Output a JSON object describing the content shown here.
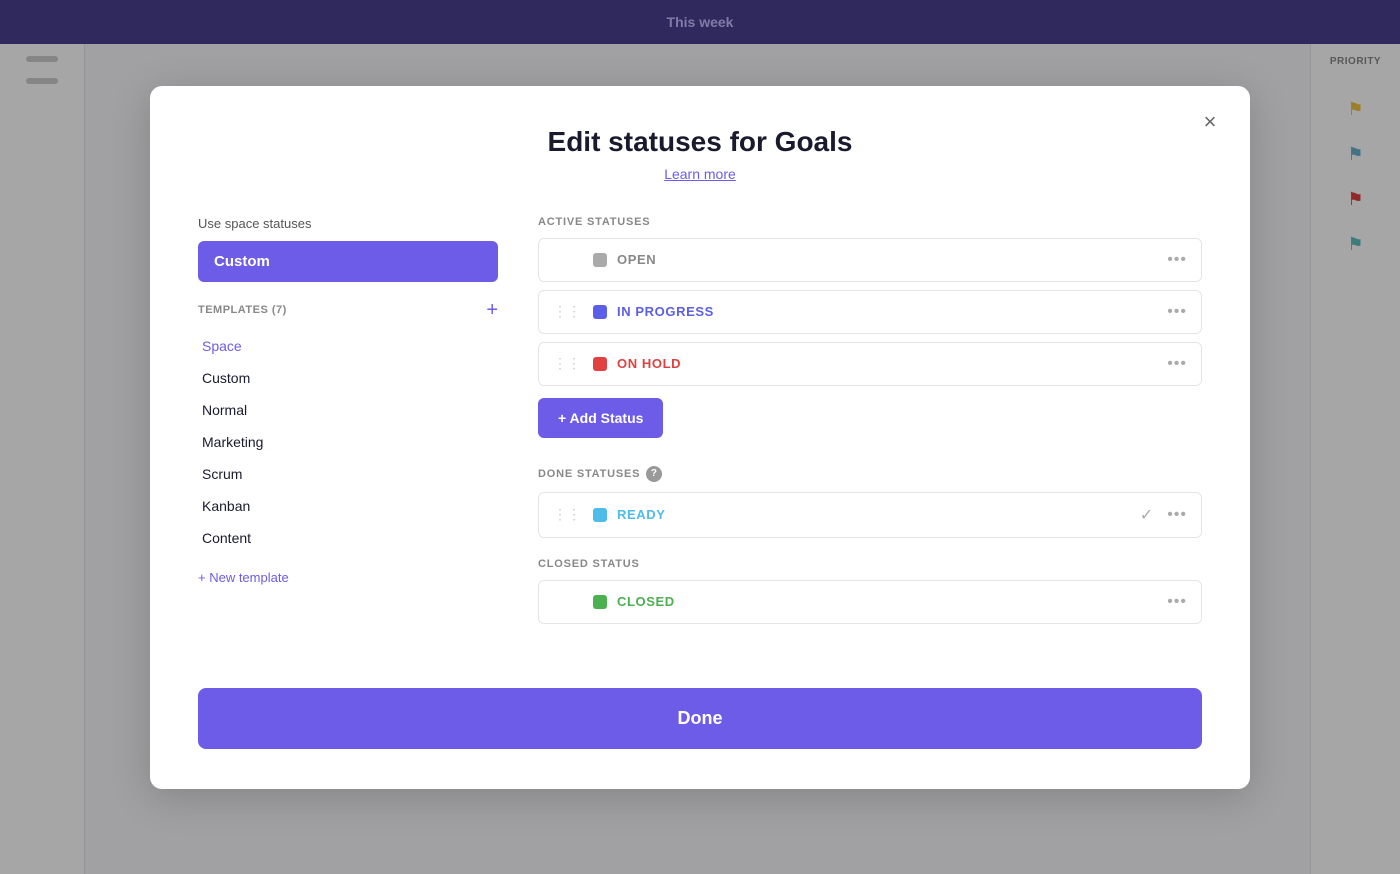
{
  "app": {
    "topbar_title": "This week",
    "priority_label": "PRIORITY"
  },
  "dialog": {
    "title": "Edit statuses for Goals",
    "learn_more": "Learn more",
    "close_label": "×",
    "left": {
      "use_space_label": "Use space statuses",
      "custom_btn_label": "Custom",
      "templates_label": "TEMPLATES (7)",
      "templates_add_icon": "+",
      "templates": [
        {
          "label": "Space",
          "style": "active"
        },
        {
          "label": "Custom",
          "style": "plain"
        },
        {
          "label": "Normal",
          "style": "plain"
        },
        {
          "label": "Marketing",
          "style": "plain"
        },
        {
          "label": "Scrum",
          "style": "plain"
        },
        {
          "label": "Kanban",
          "style": "plain"
        },
        {
          "label": "Content",
          "style": "plain"
        }
      ],
      "new_template_label": "+ New template"
    },
    "right": {
      "active_section_label": "ACTIVE STATUSES",
      "active_statuses": [
        {
          "name": "OPEN",
          "color": "gray",
          "dot_class": "dot-gray",
          "name_class": "name-gray",
          "has_drag": false
        },
        {
          "name": "IN PROGRESS",
          "color": "blue",
          "dot_class": "dot-blue",
          "name_class": "name-blue",
          "has_drag": true
        },
        {
          "name": "ON HOLD",
          "color": "red",
          "dot_class": "dot-red",
          "name_class": "name-red",
          "has_drag": true
        }
      ],
      "add_status_label": "+ Add Status",
      "done_section_label": "DONE STATUSES",
      "done_statuses": [
        {
          "name": "READY",
          "color": "blue2",
          "dot_class": "dot-blue2",
          "name_class": "name-blue2",
          "has_drag": true,
          "has_check": true
        }
      ],
      "closed_section_label": "CLOSED STATUS",
      "closed_statuses": [
        {
          "name": "CLOSED",
          "color": "green",
          "dot_class": "dot-green",
          "name_class": "name-green",
          "has_drag": false
        }
      ]
    },
    "done_btn_label": "Done"
  }
}
